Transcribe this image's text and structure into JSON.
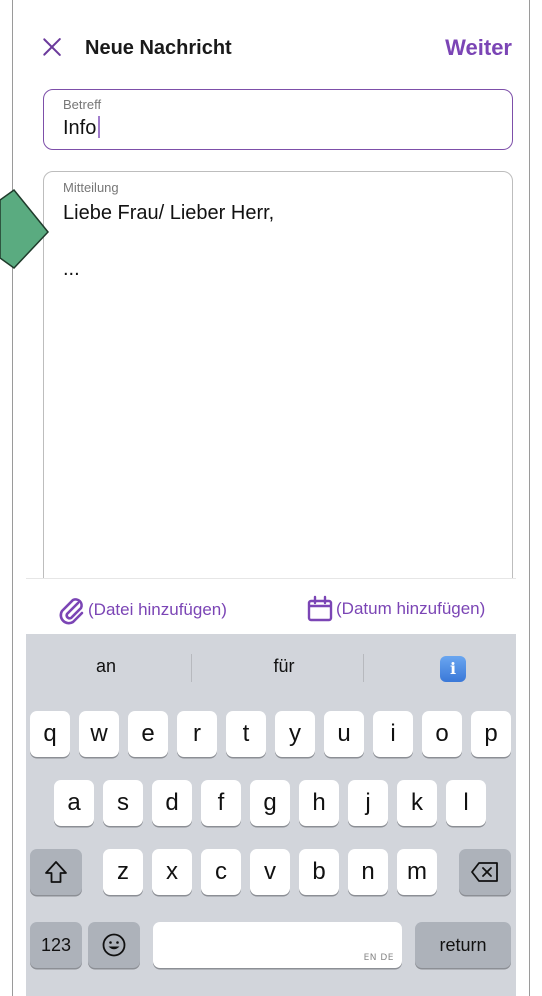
{
  "header": {
    "title": "Neue Nachricht",
    "next_label": "Weiter",
    "close_icon": "close-icon"
  },
  "subject": {
    "label": "Betreff",
    "value": "Info"
  },
  "message": {
    "label": "Mitteilung",
    "lines": [
      "Liebe Frau/ Lieber Herr,",
      "",
      "..."
    ]
  },
  "attachments": {
    "file_label": "(Datei hinzufügen)",
    "date_label": "(Datum hinzufügen)",
    "file_icon": "paperclip-icon",
    "date_icon": "calendar-icon"
  },
  "keyboard": {
    "suggestions": [
      "an",
      "für"
    ],
    "info_icon": "info-icon",
    "row1": [
      "q",
      "w",
      "e",
      "r",
      "t",
      "y",
      "u",
      "i",
      "o",
      "p"
    ],
    "row2": [
      "a",
      "s",
      "d",
      "f",
      "g",
      "h",
      "j",
      "k",
      "l"
    ],
    "row3": [
      "z",
      "x",
      "c",
      "v",
      "b",
      "n",
      "m"
    ],
    "numbers_label": "123",
    "space_hint": "EN DE",
    "return_label": "return",
    "emoji_icon": "emoji-icon",
    "shift_icon": "shift-icon",
    "delete_icon": "delete-icon"
  },
  "colors": {
    "accent": "#7b45b5",
    "pointer_green": "#5aab80"
  }
}
